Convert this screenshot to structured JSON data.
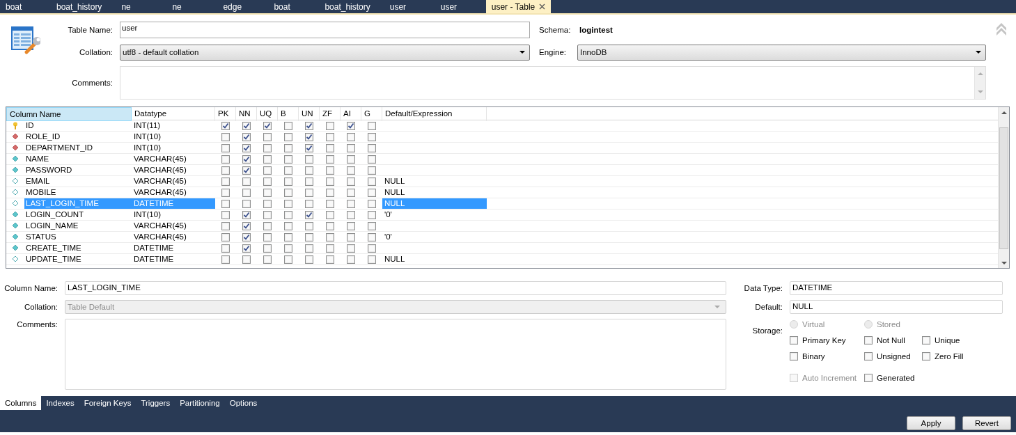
{
  "document_tabs": [
    {
      "label": "boat",
      "selected": false
    },
    {
      "label": "boat_history",
      "selected": false
    },
    {
      "label": "ne",
      "selected": false
    },
    {
      "label": "ne",
      "selected": false
    },
    {
      "label": "edge",
      "selected": false
    },
    {
      "label": "boat",
      "selected": false
    },
    {
      "label": "boat_history",
      "selected": false
    },
    {
      "label": "user",
      "selected": false
    },
    {
      "label": "user",
      "selected": false
    },
    {
      "label": "user - Table",
      "selected": true
    }
  ],
  "table": {
    "name_label": "Table Name:",
    "name": "user",
    "schema_label": "Schema:",
    "schema": "logintest",
    "collation_label": "Collation:",
    "collation": "utf8 - default collation",
    "engine_label": "Engine:",
    "engine": "InnoDB",
    "comments_label": "Comments:"
  },
  "grid": {
    "columns": [
      "Column Name",
      "Datatype",
      "PK",
      "NN",
      "UQ",
      "B",
      "UN",
      "ZF",
      "AI",
      "G",
      "Default/Expression"
    ],
    "rows": [
      {
        "name": "ID",
        "datatype": "INT(11)",
        "kind": "primary",
        "flags": [
          true,
          true,
          true,
          false,
          true,
          false,
          true,
          false
        ],
        "selected": false
      },
      {
        "name": "ROLE_ID",
        "datatype": "INT(10)",
        "kind": "foreign",
        "flags": [
          false,
          true,
          false,
          false,
          true,
          false,
          false,
          false
        ],
        "selected": false
      },
      {
        "name": "DEPARTMENT_ID",
        "datatype": "INT(10)",
        "kind": "foreign",
        "flags": [
          false,
          true,
          false,
          false,
          true,
          false,
          false,
          false
        ],
        "selected": false
      },
      {
        "name": "NAME",
        "datatype": "VARCHAR(45)",
        "kind": "not_null",
        "flags": [
          false,
          true,
          false,
          false,
          false,
          false,
          false,
          false
        ],
        "selected": false
      },
      {
        "name": "PASSWORD",
        "datatype": "VARCHAR(45)",
        "kind": "not_null",
        "flags": [
          false,
          true,
          false,
          false,
          false,
          false,
          false,
          false
        ],
        "selected": false
      },
      {
        "name": "EMAIL",
        "datatype": "VARCHAR(45)",
        "kind": "nullable",
        "flags": [
          false,
          false,
          false,
          false,
          false,
          false,
          false,
          false
        ],
        "default": "NULL",
        "selected": false
      },
      {
        "name": "MOBILE",
        "datatype": "VARCHAR(45)",
        "kind": "nullable",
        "flags": [
          false,
          false,
          false,
          false,
          false,
          false,
          false,
          false
        ],
        "default": "NULL",
        "selected": false
      },
      {
        "name": "LAST_LOGIN_TIME",
        "datatype": "DATETIME",
        "kind": "nullable",
        "flags": [
          false,
          false,
          false,
          false,
          false,
          false,
          false,
          false
        ],
        "default": "NULL",
        "selected": true
      },
      {
        "name": "LOGIN_COUNT",
        "datatype": "INT(10)",
        "kind": "not_null",
        "flags": [
          false,
          true,
          false,
          false,
          true,
          false,
          false,
          false
        ],
        "default": "'0'",
        "selected": false
      },
      {
        "name": "LOGIN_NAME",
        "datatype": "VARCHAR(45)",
        "kind": "not_null",
        "flags": [
          false,
          true,
          false,
          false,
          false,
          false,
          false,
          false
        ],
        "selected": false
      },
      {
        "name": "STATUS",
        "datatype": "VARCHAR(45)",
        "kind": "not_null",
        "flags": [
          false,
          true,
          false,
          false,
          false,
          false,
          false,
          false
        ],
        "default": "'0'",
        "selected": false
      },
      {
        "name": "CREATE_TIME",
        "datatype": "DATETIME",
        "kind": "not_null",
        "flags": [
          false,
          true,
          false,
          false,
          false,
          false,
          false,
          false
        ],
        "selected": false
      },
      {
        "name": "UPDATE_TIME",
        "datatype": "DATETIME",
        "kind": "nullable",
        "flags": [
          false,
          false,
          false,
          false,
          false,
          false,
          false,
          false
        ],
        "default": "NULL",
        "selected": false
      }
    ]
  },
  "details": {
    "column_name_label": "Column Name:",
    "column_name": "LAST_LOGIN_TIME",
    "collation_label": "Collation:",
    "collation": "Table Default",
    "collation_disabled": true,
    "comments_label": "Comments:",
    "data_type_label": "Data Type:",
    "data_type": "DATETIME",
    "default_label": "Default:",
    "default": "NULL",
    "storage_label": "Storage:",
    "storage": [
      {
        "label": "Virtual",
        "selected": false,
        "disabled": true
      },
      {
        "label": "Stored",
        "selected": false,
        "disabled": true
      }
    ],
    "options": [
      {
        "label": "Primary Key",
        "checked": false,
        "disabled": false
      },
      {
        "label": "Not Null",
        "checked": false,
        "disabled": false
      },
      {
        "label": "Unique",
        "checked": false,
        "disabled": false
      },
      {
        "label": "Binary",
        "checked": false,
        "disabled": false
      },
      {
        "label": "Unsigned",
        "checked": false,
        "disabled": false
      },
      {
        "label": "Zero Fill",
        "checked": false,
        "disabled": false
      },
      {
        "label": "Auto Increment",
        "checked": false,
        "disabled": true
      },
      {
        "label": "Generated",
        "checked": false,
        "disabled": false
      }
    ]
  },
  "editor_tabs": [
    {
      "label": "Columns",
      "selected": true
    },
    {
      "label": "Indexes",
      "selected": false
    },
    {
      "label": "Foreign Keys",
      "selected": false
    },
    {
      "label": "Triggers",
      "selected": false
    },
    {
      "label": "Partitioning",
      "selected": false
    },
    {
      "label": "Options",
      "selected": false
    }
  ],
  "buttons": [
    "Apply",
    "Revert"
  ]
}
